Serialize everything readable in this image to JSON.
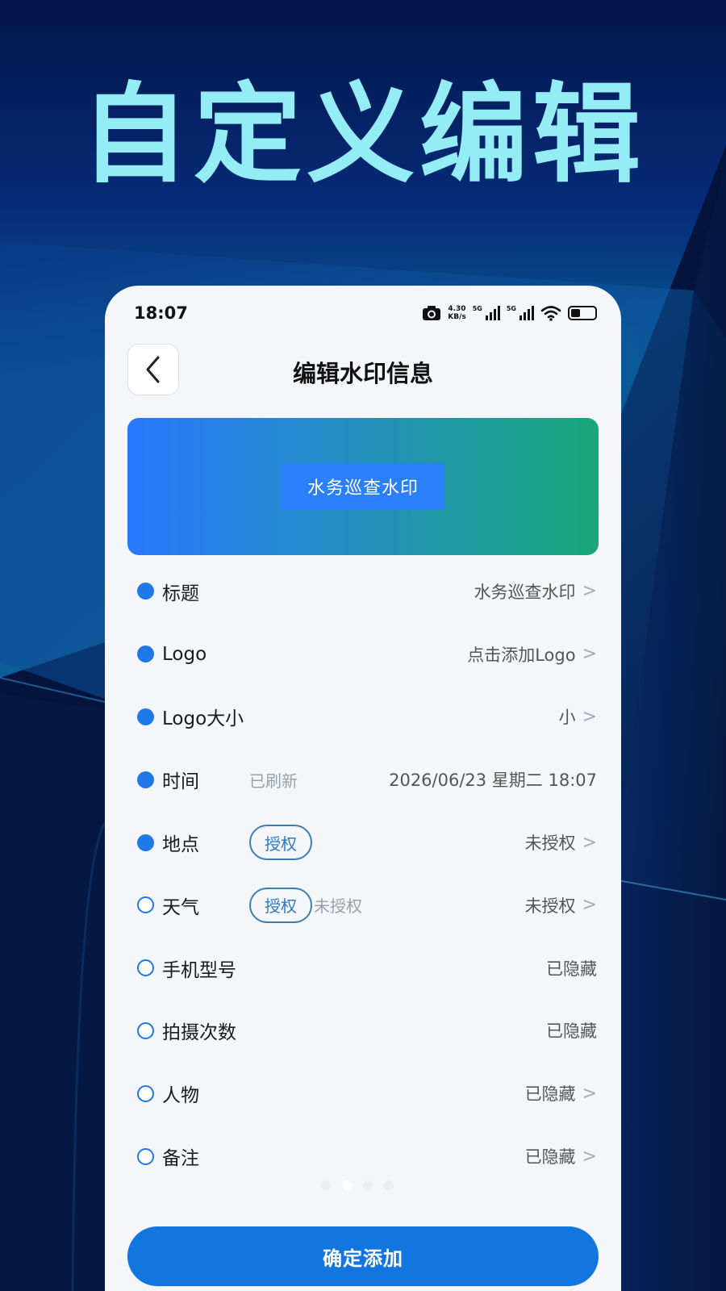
{
  "hero": {
    "title": "自定义编辑",
    "title_color": "#94ecf5"
  },
  "status_bar": {
    "time": "18:07",
    "speed_value": "4.30",
    "speed_unit": "KB/s",
    "network_1": "5G",
    "network_2": "5G"
  },
  "header": {
    "title": "编辑水印信息"
  },
  "preview": {
    "watermark_label": "水务巡查水印"
  },
  "rows": {
    "title": {
      "label": "标题",
      "value": "水务巡查水印",
      "enabled": true,
      "chevron": ">"
    },
    "logo": {
      "label": "Logo",
      "value": "点击添加Logo",
      "enabled": true,
      "chevron": ">"
    },
    "logo_size": {
      "label": "Logo大小",
      "value": "小",
      "enabled": true,
      "chevron": ">"
    },
    "time": {
      "label": "时间",
      "status": "已刷新",
      "value": "2026/06/23 星期二  18:07",
      "enabled": true
    },
    "location": {
      "label": "地点",
      "auth_button": "授权",
      "value": "未授权",
      "enabled": true,
      "chevron": ">"
    },
    "weather": {
      "label": "天气",
      "auth_button": "授权",
      "status": "未授权",
      "value": "未授权",
      "enabled": false,
      "chevron": ">"
    },
    "phone_model": {
      "label": "手机型号",
      "value": "已隐藏",
      "enabled": false
    },
    "shot_count": {
      "label": "拍摄次数",
      "value": "已隐藏",
      "enabled": false
    },
    "person": {
      "label": "人物",
      "value": "已隐藏",
      "enabled": false,
      "chevron": ">"
    },
    "note": {
      "label": "备注",
      "value": "已隐藏",
      "enabled": false,
      "chevron": ">"
    }
  },
  "pager": {
    "count": 4,
    "active_index": 1
  },
  "footer": {
    "confirm_label": "确定添加"
  },
  "colors": {
    "accent": "#1e78e8",
    "button": "#1376e0",
    "preview_start": "#2979ff",
    "preview_end": "#1aa779"
  }
}
